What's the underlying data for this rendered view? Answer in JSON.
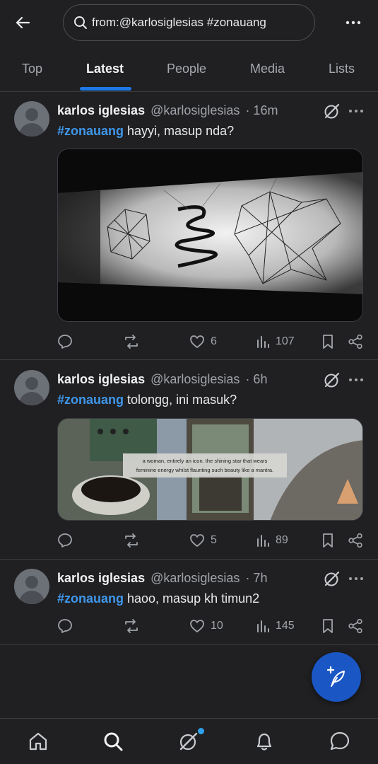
{
  "search": {
    "query": "from:@karlosiglesias #zonauang"
  },
  "tabs": [
    {
      "label": "Top"
    },
    {
      "label": "Latest"
    },
    {
      "label": "People"
    },
    {
      "label": "Media"
    },
    {
      "label": "Lists"
    }
  ],
  "active_tab": "Latest",
  "tweets": [
    {
      "name": "karlos iglesias",
      "handle": "@karlosiglesias",
      "time": "· 16m",
      "hashtag": "#zonauang",
      "text": " hayyi, masup nda?",
      "replies": "",
      "reposts": "",
      "likes": "6",
      "views": "107",
      "media": "dark photo of wire geometric sculptures and a spiral on a white wall"
    },
    {
      "name": "karlos iglesias",
      "handle": "@karlosiglesias",
      "time": "· 6h",
      "hashtag": "#zonauang",
      "text": " tolongg, ini masuk?",
      "likes": "5",
      "views": "89",
      "media_caption_1": "a woman, entirely an icon. the shining star that wears",
      "media_caption_2": "feminine energy whilst flaunting such beauty like a mantra."
    },
    {
      "name": "karlos iglesias",
      "handle": "@karlosiglesias",
      "time": "· 7h",
      "hashtag": "#zonauang",
      "text": " haoo, masup kh timun2",
      "likes": "10",
      "views": "145"
    }
  ],
  "colors": {
    "background": "#202022",
    "accent": "#1d78e8",
    "hashtag": "#3f97ea",
    "fab": "#1a56c4"
  },
  "icons": [
    "back-arrow-icon",
    "search-icon",
    "more-icon",
    "grok-icon",
    "reply-icon",
    "repost-icon",
    "like-icon",
    "views-icon",
    "bookmark-icon",
    "share-icon",
    "compose-icon",
    "home-icon",
    "explore-icon",
    "notifications-icon",
    "messages-icon"
  ]
}
